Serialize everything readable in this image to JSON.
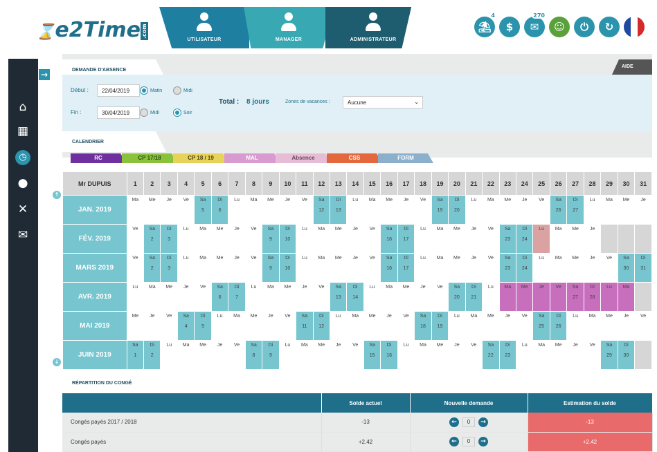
{
  "app": {
    "logo": "e2Time",
    "logo_tag": ".com"
  },
  "nav": [
    {
      "label": "UTILISATEUR",
      "color": "#1f7fa0"
    },
    {
      "label": "MANAGER",
      "color": "#38a8b3"
    },
    {
      "label": "ADMINISTRATEUR",
      "color": "#1e5c70"
    }
  ],
  "header_icons": [
    {
      "name": "vacation-icon",
      "glyph": "⛱",
      "badge": "4"
    },
    {
      "name": "wallet-icon",
      "glyph": "$",
      "badge": ""
    },
    {
      "name": "mail-icon",
      "glyph": "✉",
      "badge": "270"
    },
    {
      "name": "avatar",
      "glyph": "☺",
      "badge": ""
    },
    {
      "name": "power-icon",
      "glyph": "⏻",
      "badge": ""
    },
    {
      "name": "refresh-icon",
      "glyph": "↻",
      "badge": ""
    },
    {
      "name": "flag-fr-icon",
      "glyph": "",
      "badge": ""
    }
  ],
  "request": {
    "tab": "DEMANDE D'ABSENCE",
    "help": "AIDE",
    "start_label": "Début :",
    "start_value": "22/04/2019",
    "start_am": "Matin",
    "start_pm": "Midi",
    "end_label": "Fin :",
    "end_value": "30/04/2019",
    "end_noon": "Midi",
    "end_evening": "Soir",
    "total_label": "Total :",
    "total_value": "8 jours",
    "zones_label": "Zones de vacances :",
    "zones_value": "Aucune"
  },
  "calendar": {
    "tab": "CALENDRIER",
    "legend": [
      {
        "label": "RC",
        "color": "#6f2f9f",
        "text": "#fff"
      },
      {
        "label": "CP 17/18",
        "color": "#8ac33b",
        "text": "#2a4a10"
      },
      {
        "label": "CP 18 / 19",
        "color": "#e8d35a",
        "text": "#4a4010"
      },
      {
        "label": "MAL",
        "color": "#d99ad0",
        "text": "#fff"
      },
      {
        "label": "Absence",
        "color": "#e7bcd6",
        "text": "#6a4a5a"
      },
      {
        "label": "CSS",
        "color": "#e3683d",
        "text": "#fff"
      },
      {
        "label": "FORM",
        "color": "#8cb0cc",
        "text": "#fff"
      }
    ],
    "employee": "Mr DUPUIS",
    "days": [
      "1",
      "2",
      "3",
      "4",
      "5",
      "6",
      "7",
      "8",
      "9",
      "10",
      "11",
      "12",
      "13",
      "14",
      "15",
      "16",
      "17",
      "18",
      "19",
      "20",
      "21",
      "22",
      "23",
      "24",
      "25",
      "26",
      "27",
      "28",
      "29",
      "30",
      "31"
    ],
    "months": [
      {
        "label": "JAN. 2019",
        "cells": [
          "Ma",
          "Me",
          "Je",
          "Ve",
          "Sa|5",
          "Di|6",
          "Lu",
          "Ma",
          "Me",
          "Je",
          "Ve",
          "Sa|12",
          "Di|13",
          "Lu",
          "Ma",
          "Me",
          "Je",
          "Ve",
          "Sa|19",
          "Di|20",
          "Lu",
          "Ma",
          "Me",
          "Je",
          "Ve",
          "Sa|26",
          "Di|27",
          "Lu",
          "Ma",
          "Me",
          "Je"
        ]
      },
      {
        "label": "FÉV. 2019",
        "cells": [
          "Ve",
          "Sa|2",
          "Di|3",
          "Lu",
          "Ma",
          "Me",
          "Je",
          "Ve",
          "Sa|9",
          "Di|10",
          "Lu",
          "Ma",
          "Me",
          "Je",
          "Ve",
          "Sa|16",
          "Di|17",
          "Lu",
          "Ma",
          "Me",
          "Je",
          "Ve",
          "Sa|23",
          "Di|24",
          "Lu",
          "Ma",
          "Me",
          "Je",
          "",
          "",
          ""
        ]
      },
      {
        "label": "MARS 2019",
        "cells": [
          "Ve",
          "Sa|2",
          "Di|3",
          "Lu",
          "Ma",
          "Me",
          "Je",
          "Ve",
          "Sa|9",
          "Di|10",
          "Lu",
          "Ma",
          "Me",
          "Je",
          "Ve",
          "Sa|16",
          "Di|17",
          "Lu",
          "Ma",
          "Me",
          "Je",
          "Ve",
          "Sa|23",
          "Di|24",
          "Lu",
          "Ma",
          "Me",
          "Je",
          "Ve",
          "Sa|30",
          "Di|31"
        ]
      },
      {
        "label": "AVR. 2019",
        "cells": [
          "Lu",
          "Ma",
          "Me",
          "Je",
          "Ve",
          "Sa|6",
          "Di|7",
          "Lu",
          "Ma",
          "Me",
          "Je",
          "Ve",
          "Sa|13",
          "Di|14",
          "Lu",
          "Ma",
          "Me",
          "Je",
          "Ve",
          "Sa|20",
          "Di|21",
          "Lu",
          "Ma",
          "Me",
          "Je",
          "Ve",
          "Sa|27",
          "Di|28",
          "Lu",
          "Ma",
          ""
        ]
      },
      {
        "label": "MAI 2019",
        "cells": [
          "Me",
          "Je",
          "Ve",
          "Sa|4",
          "Di|5",
          "Lu",
          "Ma",
          "Me",
          "Je",
          "Ve",
          "Sa|11",
          "Di|12",
          "Lu",
          "Ma",
          "Me",
          "Je",
          "Ve",
          "Sa|18",
          "Di|19",
          "Lu",
          "Ma",
          "Me",
          "Je",
          "Ve",
          "Sa|25",
          "Di|26",
          "Lu",
          "Ma",
          "Me",
          "Je",
          "Ve"
        ]
      },
      {
        "label": "JUIN 2019",
        "cells": [
          "Sa|1",
          "Di|2",
          "Lu",
          "Ma",
          "Me",
          "Je",
          "Ve",
          "Sa|8",
          "Di|9",
          "Lu",
          "Ma",
          "Me",
          "Je",
          "Ve",
          "Sa|15",
          "Di|16",
          "Lu",
          "Ma",
          "Me",
          "Je",
          "Ve",
          "Sa|22",
          "Di|23",
          "Lu",
          "Ma",
          "Me",
          "Je",
          "Ve",
          "Sa|29",
          "Di|30",
          ""
        ]
      }
    ]
  },
  "repartition": {
    "tab": "RÉPARTITION DU CONGÉ",
    "headers": [
      "",
      "Solde actuel",
      "Nouvelle demande",
      "Estimation du solde"
    ],
    "rows": [
      {
        "label": "Congés payés 2017 / 2018",
        "solde": "-13",
        "value": "0",
        "estimation": "-13"
      },
      {
        "label": "Congés payés",
        "solde": "+2.42",
        "value": "0",
        "estimation": "+2.42"
      }
    ]
  }
}
